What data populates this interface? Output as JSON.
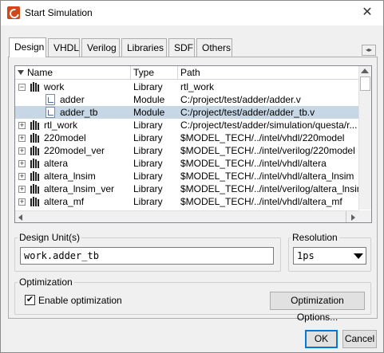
{
  "window": {
    "title": "Start Simulation",
    "close_glyph": "✕"
  },
  "tabs": [
    {
      "label": "Design",
      "active": true
    },
    {
      "label": "VHDL",
      "active": false
    },
    {
      "label": "Verilog",
      "active": false
    },
    {
      "label": "Libraries",
      "active": false
    },
    {
      "label": "SDF",
      "active": false
    },
    {
      "label": "Others",
      "active": false
    }
  ],
  "tab_scroll_glyph": "◂▸",
  "tree": {
    "columns": [
      "Name",
      "Type",
      "Path"
    ],
    "rows": [
      {
        "name": "work",
        "type": "Library",
        "path": "rtl_work",
        "expander": "−",
        "icon": "library-icon"
      },
      {
        "name": "adder",
        "type": "Module",
        "path": "C:/project/test/adder/adder.v",
        "expander": "",
        "icon": "module-icon"
      },
      {
        "name": "adder_tb",
        "type": "Module",
        "path": "C:/project/test/adder/adder_tb.v",
        "expander": "",
        "icon": "module-icon",
        "selected": true
      },
      {
        "name": "rtl_work",
        "type": "Library",
        "path": "C:/project/test/adder/simulation/questa/r...",
        "expander": "+",
        "icon": "library-icon"
      },
      {
        "name": "220model",
        "type": "Library",
        "path": "$MODEL_TECH/../intel/vhdl/220model",
        "expander": "+",
        "icon": "library-icon"
      },
      {
        "name": "220model_ver",
        "type": "Library",
        "path": "$MODEL_TECH/../intel/verilog/220model",
        "expander": "+",
        "icon": "library-icon"
      },
      {
        "name": "altera",
        "type": "Library",
        "path": "$MODEL_TECH/../intel/vhdl/altera",
        "expander": "+",
        "icon": "library-icon"
      },
      {
        "name": "altera_lnsim",
        "type": "Library",
        "path": "$MODEL_TECH/../intel/vhdl/altera_lnsim",
        "expander": "+",
        "icon": "library-icon"
      },
      {
        "name": "altera_lnsim_ver",
        "type": "Library",
        "path": "$MODEL_TECH/../intel/verilog/altera_lnsim",
        "expander": "+",
        "icon": "library-icon"
      },
      {
        "name": "altera_mf",
        "type": "Library",
        "path": "$MODEL_TECH/../intel/vhdl/altera_mf",
        "expander": "+",
        "icon": "library-icon"
      }
    ]
  },
  "design_unit": {
    "label": "Design Unit(s)",
    "value": "work.adder_tb"
  },
  "resolution": {
    "label": "Resolution",
    "value": "1ps"
  },
  "optimization": {
    "label": "Optimization",
    "enable_label": "Enable optimization",
    "enabled": true,
    "checkmark": "✔",
    "options_button": "Optimization Options..."
  },
  "buttons": {
    "ok": "OK",
    "cancel": "Cancel"
  }
}
